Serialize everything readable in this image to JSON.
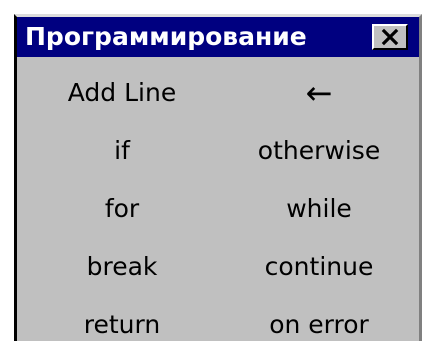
{
  "window": {
    "title": "Программирование",
    "close_glyph": "✕"
  },
  "buttons": [
    {
      "left": "Add Line",
      "right": "←"
    },
    {
      "left": "if",
      "right": "otherwise"
    },
    {
      "left": "for",
      "right": "while"
    },
    {
      "left": "break",
      "right": "continue"
    },
    {
      "left": "return",
      "right": "on error"
    }
  ],
  "colors": {
    "titlebar": "#000080",
    "title_text": "#ffffff",
    "face": "#c0c0c0"
  }
}
